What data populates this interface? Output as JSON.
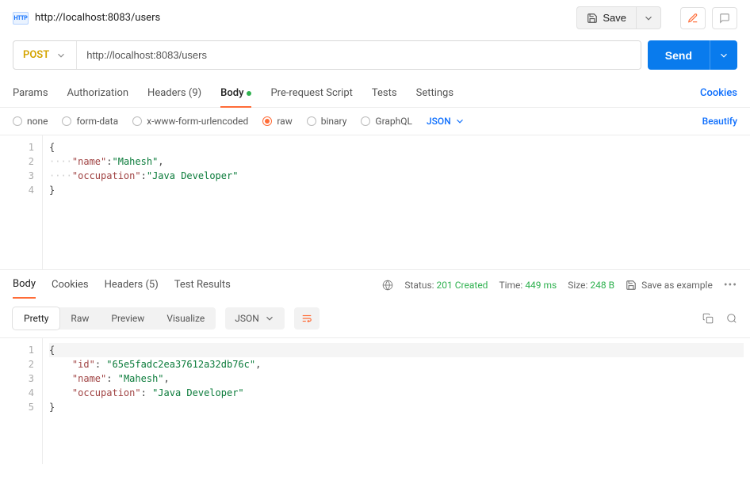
{
  "header": {
    "title": "http://localhost:8083/users",
    "save_label": "Save"
  },
  "request": {
    "method": "POST",
    "url_value": "http://localhost:8083/users",
    "send_label": "Send"
  },
  "tabs": {
    "params": "Params",
    "auth": "Authorization",
    "headers_label": "Headers",
    "headers_count": "(9)",
    "body": "Body",
    "prerequest": "Pre-request Script",
    "tests": "Tests",
    "settings": "Settings",
    "cookies": "Cookies"
  },
  "body_types": {
    "none": "none",
    "formdata": "form-data",
    "urlenc": "x-www-form-urlencoded",
    "raw": "raw",
    "binary": "binary",
    "graphql": "GraphQL",
    "format": "JSON",
    "beautify": "Beautify"
  },
  "editor": {
    "lines": [
      "1",
      "2",
      "3",
      "4"
    ],
    "body_name_key": "\"name\"",
    "body_name_val": "\"Mahesh\"",
    "body_occ_key": "\"occupation\"",
    "body_occ_val": "\"Java Developer\""
  },
  "response_tabs": {
    "body": "Body",
    "cookies": "Cookies",
    "headers_label": "Headers",
    "headers_count": "(5)",
    "testresults": "Test Results"
  },
  "response_meta": {
    "status_label": "Status:",
    "status_value": "201 Created",
    "time_label": "Time:",
    "time_value": "449 ms",
    "size_label": "Size:",
    "size_value": "248 B",
    "save_example": "Save as example"
  },
  "response_toolbar": {
    "pretty": "Pretty",
    "raw": "Raw",
    "preview": "Preview",
    "visualize": "Visualize",
    "format": "JSON"
  },
  "response_editor": {
    "lines": [
      "1",
      "2",
      "3",
      "4",
      "5"
    ],
    "id_key": "\"id\"",
    "id_val": "\"65e5fadc2ea37612a32db76c\"",
    "name_key": "\"name\"",
    "name_val": "\"Mahesh\"",
    "occ_key": "\"occupation\"",
    "occ_val": "\"Java Developer\""
  }
}
